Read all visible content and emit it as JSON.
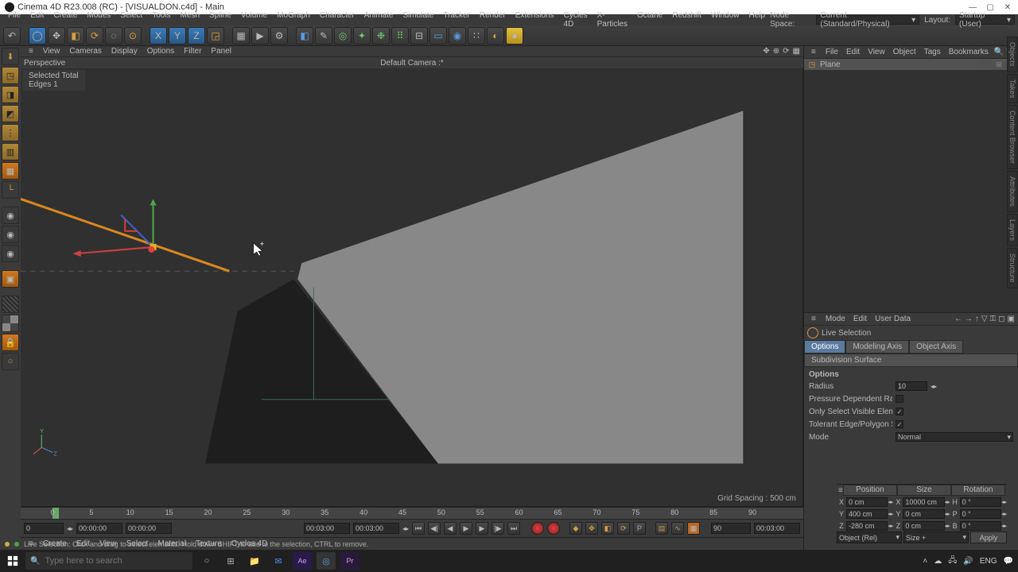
{
  "title": "Cinema 4D R23.008 (RC) - [VISUALDON.c4d] - Main",
  "menu": [
    "File",
    "Edit",
    "Create",
    "Modes",
    "Select",
    "Tools",
    "Mesh",
    "Spline",
    "Volume",
    "MoGraph",
    "Character",
    "Animate",
    "Simulate",
    "Tracker",
    "Render",
    "Extensions",
    "Cycles 4D",
    "X-Particles",
    "Octane",
    "Redshift",
    "Window",
    "Help"
  ],
  "nodespace_label": "Node Space:",
  "nodespace_value": "Current (Standard/Physical)",
  "layout_label": "Layout:",
  "layout_value": "Startup (User)",
  "vp_menu": [
    "View",
    "Cameras",
    "Display",
    "Options",
    "Filter",
    "Panel"
  ],
  "vp_mode": "Perspective",
  "vp_camera": "Default Camera :*",
  "hud": {
    "line1": "Selected Total",
    "line2": "Edges   1"
  },
  "grid_spacing": "Grid Spacing : 500 cm",
  "objects": {
    "menu": [
      "File",
      "Edit",
      "View",
      "Object",
      "Tags",
      "Bookmarks"
    ],
    "items": [
      {
        "name": "Plane",
        "icon": "plane-icon"
      }
    ]
  },
  "attributes": {
    "menu": [
      "Mode",
      "Edit",
      "User Data"
    ],
    "tool_name": "Live Selection",
    "tabs": [
      "Options",
      "Modeling Axis",
      "Object Axis",
      "Subdivision Surface"
    ],
    "active_tab": "Options",
    "section": "Options",
    "radius": "10",
    "pressure_dependent": false,
    "only_visible": true,
    "tolerant_edge": true,
    "mode": "Normal"
  },
  "timeline": {
    "ticks": [
      0,
      5,
      10,
      15,
      20,
      25,
      30,
      35,
      40,
      45,
      50,
      55,
      60,
      65,
      70,
      75,
      80,
      85,
      90
    ],
    "start_frame": "0",
    "current_frame": "0",
    "start_tc": "00:00:00",
    "current_tc": "00:00:00",
    "end_tc": "00:03:00",
    "end_tc2": "00:03:00",
    "end_frame": "90",
    "end_frame2": "90"
  },
  "materials_menu": [
    "Create",
    "Edit",
    "View",
    "Select",
    "Material",
    "Texture",
    "Cycles 4D"
  ],
  "coords": {
    "headers": [
      "Position",
      "Size",
      "Rotation"
    ],
    "rows": [
      {
        "axis": "X",
        "pos": "0 cm",
        "sizeax": "X",
        "size": "10000 cm",
        "rotax": "H",
        "rot": "0 °"
      },
      {
        "axis": "Y",
        "pos": "400 cm",
        "sizeax": "Y",
        "size": "0 cm",
        "rotax": "P",
        "rot": "0 °"
      },
      {
        "axis": "Z",
        "pos": "-280 cm",
        "sizeax": "Z",
        "size": "0 cm",
        "rotax": "B",
        "rot": "0 °"
      }
    ],
    "space": "Object (Rel)",
    "size_mode": "Size +",
    "apply": "Apply"
  },
  "status": "Live Selection: Click and drag to select elements. Hold down SHIFT to add to the selection, CTRL to remove.",
  "taskbar": {
    "search_placeholder": "Type here to search",
    "time": "",
    "apps": [
      "cortana",
      "taskview",
      "explorer",
      "mail",
      "aftereffects",
      "cinema4d",
      "premiere"
    ]
  },
  "side_tabs": [
    "Objects",
    "Takes",
    "Content Browser",
    "Attributes",
    "Layers",
    "Structure"
  ]
}
